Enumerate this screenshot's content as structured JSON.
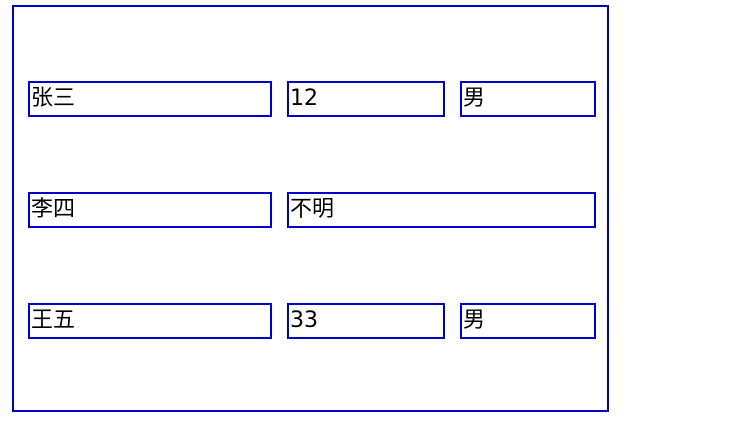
{
  "rows": [
    {
      "name": "张三",
      "age": "12",
      "gender": "男"
    },
    {
      "name": "李四",
      "merged": "不明"
    },
    {
      "name": "王五",
      "age": "33",
      "gender": "男"
    }
  ],
  "footer": {
    "text": ""
  },
  "colors": {
    "border": "#0000c8",
    "text": "#000000",
    "background": "#ffffff"
  }
}
